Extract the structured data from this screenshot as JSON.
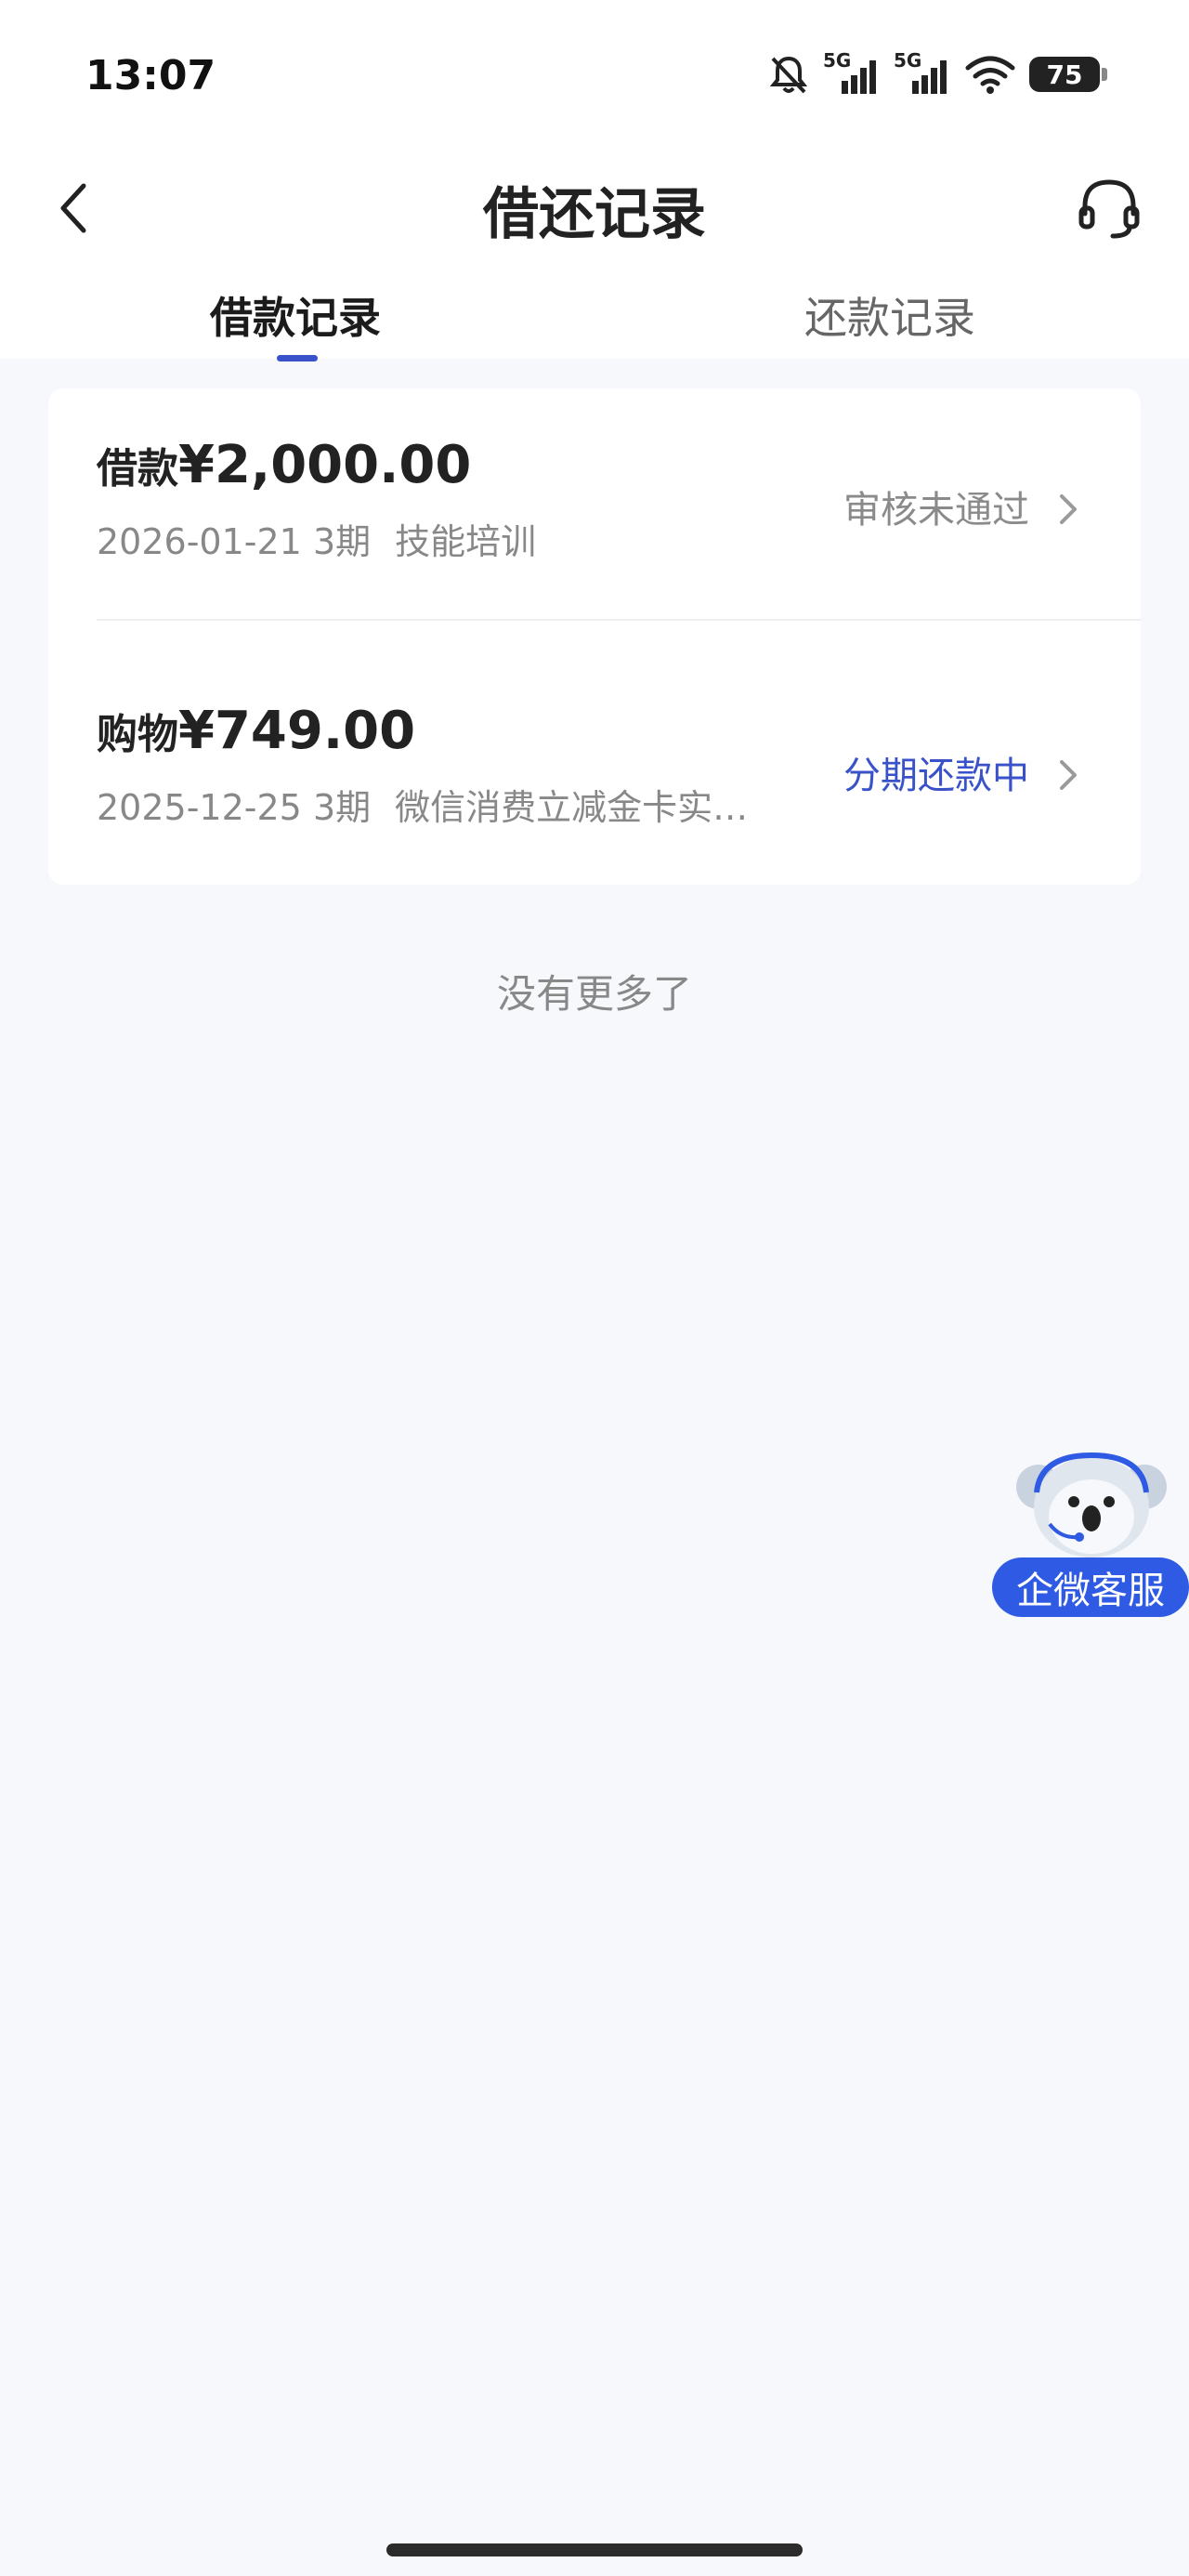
{
  "status_bar": {
    "time": "13:07",
    "battery": "75",
    "network_1": "5G",
    "network_2": "5G"
  },
  "nav": {
    "title": "借还记录",
    "back_icon": "chevron-left-icon",
    "service_icon": "headset-icon"
  },
  "tabs": [
    {
      "label": "借款记录",
      "active": true
    },
    {
      "label": "还款记录",
      "active": false
    }
  ],
  "records": [
    {
      "type_label": "借款",
      "amount": "¥2,000.00",
      "date": "2026-01-21",
      "term": "3期",
      "purpose": "技能培训",
      "status": "审核未通过"
    },
    {
      "type_label": "购物",
      "amount": "¥749.00",
      "date": "2025-12-25",
      "term": "3期",
      "purpose": "微信消费立减金卡实…",
      "status": "分期还款中"
    }
  ],
  "footer_text": "没有更多了",
  "float_service": {
    "label": "企微客服",
    "icon": "koala-mascot-icon"
  },
  "colors": {
    "accent": "#3a52c9",
    "float_button": "#2f5ae4",
    "background": "#f7f8fc"
  }
}
